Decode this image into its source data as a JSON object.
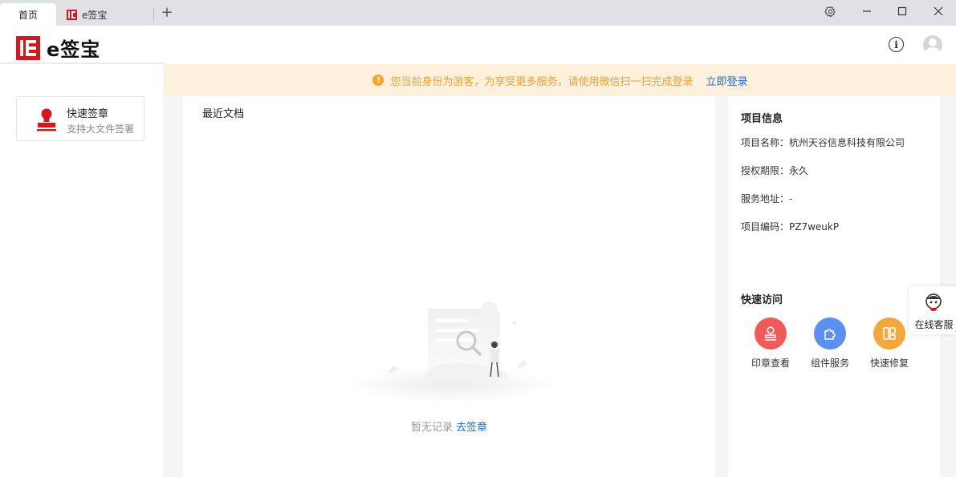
{
  "tabs": [
    {
      "label": "首页",
      "active": true
    },
    {
      "label": "e签宝",
      "active": false
    }
  ],
  "tab_add": "+",
  "window_controls": [
    "gear-icon",
    "minimize-icon",
    "maximize-icon",
    "close-icon"
  ],
  "brand": {
    "name": "e签宝",
    "color": "#d7161e"
  },
  "header": {
    "info_icon": "i"
  },
  "notice": {
    "message": "您当前身份为游客，为享受更多服务，请使用微信扫一扫完成登录",
    "action": "立即登录",
    "bg_color": "#fdf0dd",
    "text_color": "#f0a23a",
    "link_color": "#1a6fd4"
  },
  "sidebar": {
    "quick_sign": {
      "title": "快速签章",
      "subtitle": "支持大文件签署"
    }
  },
  "recent": {
    "title": "最近文档",
    "empty_text": "暂无记录",
    "empty_action": "去签章"
  },
  "project": {
    "heading": "项目信息",
    "rows": [
      "项目名称：杭州天谷信息科技有限公司",
      "授权期限：永久",
      "服务地址：-",
      "项目编码：PZ7weukP"
    ]
  },
  "quick_access": {
    "heading": "快速访问",
    "items": [
      {
        "label": "印章查看",
        "icon": "stamp-icon",
        "color": "#f05a5a"
      },
      {
        "label": "组件服务",
        "icon": "puzzle-icon",
        "color": "#5b8ff0"
      },
      {
        "label": "快速修复",
        "icon": "layout-icon",
        "color": "#f3a83b"
      }
    ]
  },
  "service": {
    "label": "在线客服"
  }
}
